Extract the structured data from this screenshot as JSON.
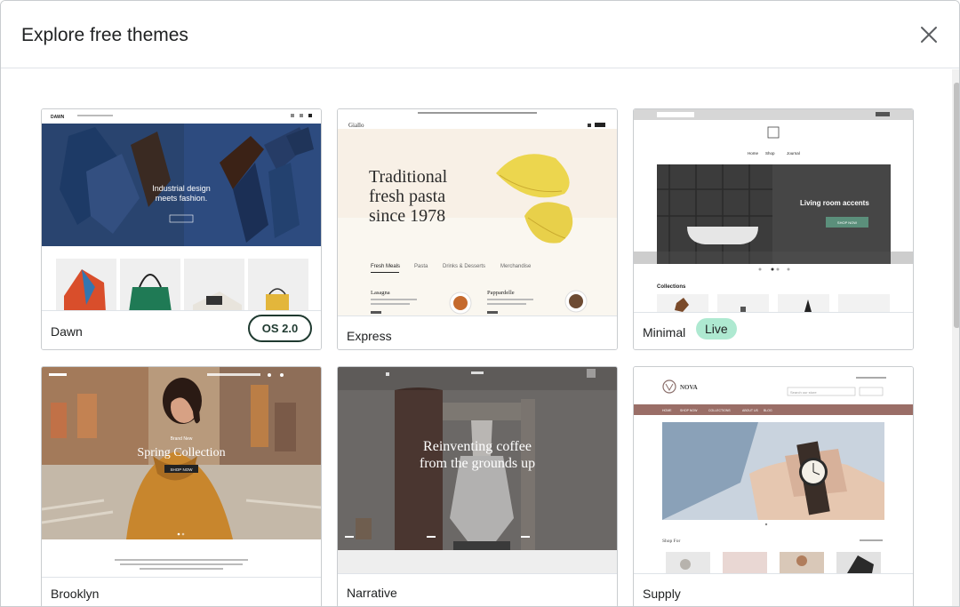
{
  "modal": {
    "title": "Explore free themes"
  },
  "themes": [
    {
      "name": "Dawn",
      "badge": "OS 2.0",
      "preview": {
        "logo": "DAWN",
        "headline_line1": "Industrial design",
        "headline_line2": "meets fashion."
      }
    },
    {
      "name": "Express",
      "preview": {
        "logo": "Giallo",
        "headline_line1": "Traditional",
        "headline_line2": "fresh pasta",
        "headline_line3": "since 1978",
        "tabs": [
          "Fresh Meals",
          "Pasta",
          "Drinks & Desserts",
          "Merchandise"
        ],
        "item1": "Lasagna",
        "item2": "Pappardelle"
      }
    },
    {
      "name": "Minimal",
      "badge": "Live",
      "preview": {
        "nav": [
          "Home",
          "Shop",
          "Journal"
        ],
        "banner": "Living room accents",
        "button": "SHOP NOW",
        "section": "Collections"
      }
    },
    {
      "name": "Brooklyn",
      "preview": {
        "eyebrow": "Brand New",
        "headline": "Spring Collection",
        "button": "SHOP NOW"
      }
    },
    {
      "name": "Narrative",
      "preview": {
        "headline_line1": "Reinventing coffee",
        "headline_line2": "from the grounds up"
      }
    },
    {
      "name": "Supply",
      "preview": {
        "logo": "NOVA",
        "search": "Search our store",
        "section": "Shop For",
        "menu": [
          "HOME",
          "SHOP NOW",
          "COLLECTIONS",
          "ABOUT US",
          "BLOG"
        ]
      }
    }
  ],
  "colors": {
    "accent_badge_border": "#1f3a30",
    "live_badge_bg": "#aee9d1",
    "supply_menu": "#9a6e67"
  }
}
